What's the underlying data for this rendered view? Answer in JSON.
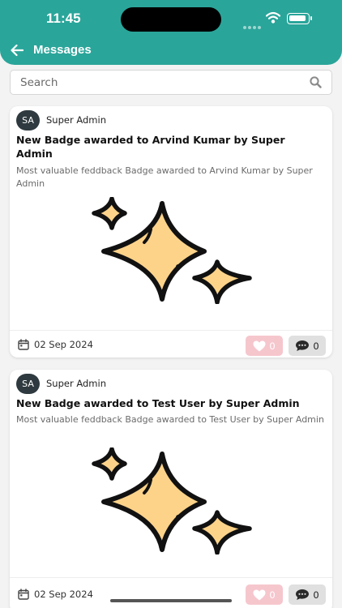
{
  "status_bar": {
    "time": "11:45"
  },
  "header": {
    "title": "Messages"
  },
  "search": {
    "placeholder": "Search",
    "value": ""
  },
  "messages": [
    {
      "avatar_initials": "SA",
      "author": "Super Admin",
      "title": "New Badge awarded to Arvind Kumar by Super Admin",
      "description": "Most valuable feddback Badge awarded to Arvind Kumar by Super Admin",
      "date": "02 Sep 2024",
      "likes": "0",
      "comments": "0"
    },
    {
      "avatar_initials": "SA",
      "author": "Super Admin",
      "title": "New Badge awarded to Test User by Super Admin",
      "description": "Most valuable feddback Badge awarded to Test User by Super Admin",
      "date": "02 Sep 2024",
      "likes": "0",
      "comments": "0"
    }
  ],
  "colors": {
    "header": "#2aa59a",
    "sparkle_fill": "#fdd38a",
    "like_bg": "#f6c6cd",
    "comment_bg": "#e0e0e0"
  },
  "icons": [
    "back-arrow-icon",
    "search-icon",
    "sparkle-icon",
    "calendar-icon",
    "heart-icon",
    "comment-icon"
  ]
}
